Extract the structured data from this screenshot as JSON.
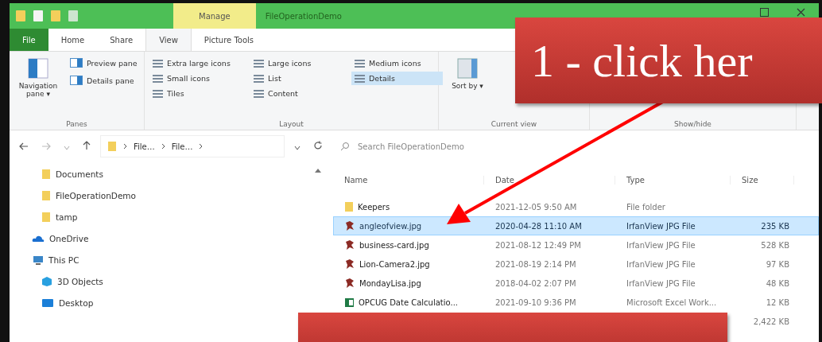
{
  "window": {
    "title": "FileOperationDemo",
    "context_tab": "Manage"
  },
  "tabs": [
    {
      "label": "File",
      "kind": "file",
      "selected": false
    },
    {
      "label": "Home",
      "kind": "tab",
      "selected": false
    },
    {
      "label": "Share",
      "kind": "tab",
      "selected": false
    },
    {
      "label": "View",
      "kind": "tab",
      "selected": true
    },
    {
      "label": "Picture Tools",
      "kind": "tab",
      "selected": false
    }
  ],
  "ribbon": {
    "panes": {
      "label": "Panes",
      "navigation_pane": "Navigation pane ▾",
      "preview_pane": "Preview pane",
      "details_pane": "Details pane"
    },
    "layout": {
      "label": "Layout",
      "options": [
        {
          "label": "Extra large icons",
          "selected": false
        },
        {
          "label": "Large icons",
          "selected": false
        },
        {
          "label": "Medium icons",
          "selected": false
        },
        {
          "label": "Small icons",
          "selected": false
        },
        {
          "label": "List",
          "selected": false
        },
        {
          "label": "Details",
          "selected": true
        },
        {
          "label": "Tiles",
          "selected": false
        },
        {
          "label": "Content",
          "selected": false
        }
      ]
    },
    "current_view": {
      "label": "Current view",
      "sort_by": "Sort by ▾"
    },
    "show_hide": {
      "label": "Show/hide"
    }
  },
  "address": {
    "crumbs": [
      "File…",
      "File…"
    ],
    "search_placeholder": "Search FileOperationDemo"
  },
  "nav_items": [
    {
      "label": "Documents",
      "kind": "folder"
    },
    {
      "label": "FileOperationDemo",
      "kind": "folder"
    },
    {
      "label": "tamp",
      "kind": "folder"
    },
    {
      "label": "OneDrive",
      "kind": "cloud"
    },
    {
      "label": "This PC",
      "kind": "pc",
      "children": [
        {
          "label": "3D Objects",
          "kind": "cube"
        },
        {
          "label": "Desktop",
          "kind": "desktop"
        }
      ]
    }
  ],
  "table": {
    "columns": [
      "Name",
      "Date",
      "Type",
      "Size"
    ],
    "rows": [
      {
        "name": "Keepers",
        "date": "2021-12-05 9:50 AM",
        "type": "File folder",
        "kind": "folder",
        "selected": false
      },
      {
        "name": "angleofview.jpg",
        "date": "2020-04-28 11:10 AM",
        "type": "IrfanView JPG File",
        "size": "235 KB",
        "kind": "image",
        "selected": true
      },
      {
        "name": "business-card.jpg",
        "date": "2021-08-12 12:49 PM",
        "type": "IrfanView JPG File",
        "size": "528 KB",
        "kind": "image",
        "selected": false
      },
      {
        "name": "Lion-Camera2.jpg",
        "date": "2021-08-19 2:14 PM",
        "type": "IrfanView JPG File",
        "size": "97 KB",
        "kind": "image",
        "selected": false
      },
      {
        "name": "MondayLisa.jpg",
        "date": "2018-04-02 2:07 PM",
        "type": "IrfanView JPG File",
        "size": "48 KB",
        "kind": "image",
        "selected": false
      },
      {
        "name": "OPCUG Date Calculatio...",
        "date": "2021-09-10 9:36 PM",
        "type": "Microsoft Excel Work...",
        "size": "12 KB",
        "kind": "excel",
        "selected": false
      },
      {
        "size": "2,422 KB",
        "kind": "hidden"
      }
    ]
  },
  "callouts": [
    {
      "text": "1 - click her",
      "kind": "top"
    },
    {
      "kind": "bottom"
    }
  ]
}
